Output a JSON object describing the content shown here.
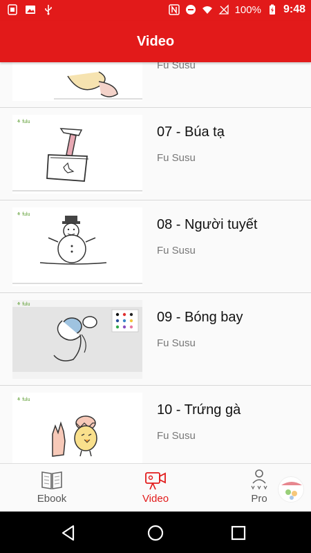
{
  "status_bar": {
    "battery": "100%",
    "time": "9:48"
  },
  "app_bar": {
    "title": "Video"
  },
  "videos": [
    {
      "title": "",
      "author": "Fu Susu"
    },
    {
      "title": "07 - Búa tạ",
      "author": "Fu Susu"
    },
    {
      "title": "08 - Người tuyết",
      "author": "Fu Susu"
    },
    {
      "title": "09 - Bóng bay",
      "author": "Fu Susu"
    },
    {
      "title": "10 - Trứng gà",
      "author": "Fu Susu"
    }
  ],
  "bottom_nav": {
    "ebook": "Ebook",
    "video": "Video",
    "pro": "Pro"
  },
  "colors": {
    "accent": "#e21a1a",
    "background": "#fafafa"
  }
}
